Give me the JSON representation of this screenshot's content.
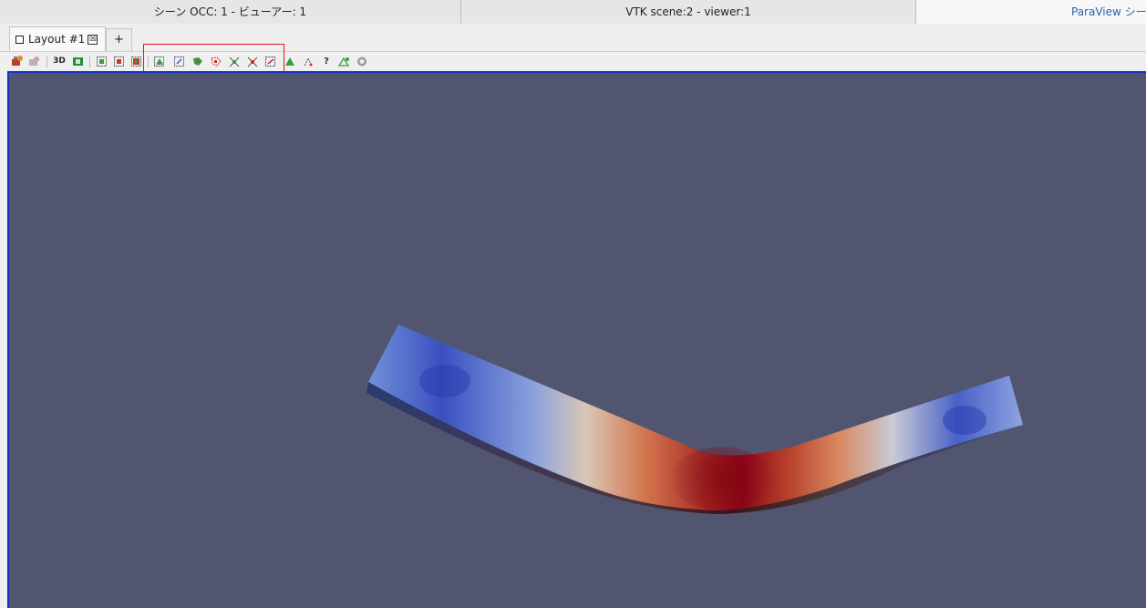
{
  "viewer_tabs": [
    {
      "label": "シーン OCC: 1 - ビューアー: 1"
    },
    {
      "label": "VTK scene:2 - viewer:1"
    },
    {
      "label": "ParaView シーン"
    }
  ],
  "layout_tab": {
    "label": "Layout #1",
    "close_glyph": "☒"
  },
  "add_tab": {
    "label": "+"
  },
  "toolbar": {
    "three_d_label": "3D",
    "query_label": "?"
  },
  "icons": [
    "reset-camera-icon",
    "zoom-to-data-icon",
    "toggle-3d-icon",
    "capture-screenshot-icon",
    "select-cells-on-icon",
    "select-points-on-icon",
    "select-cells-through-icon",
    "select-points-through-icon",
    "select-cells-polygon-icon",
    "select-points-polygon-icon",
    "select-block-icon",
    "interactive-select-cells-icon",
    "interactive-select-points-icon",
    "hover-points-icon",
    "grow-selection-icon",
    "shrink-selection-icon",
    "query-icon",
    "hover-cells-icon",
    "clear-selection-icon"
  ],
  "colors": {
    "background": "#525570",
    "active_tab_text": "#2a63b5",
    "frame": "#1432c8",
    "highlight": "#e0141e",
    "colormap_low": "#3a4fbf",
    "colormap_mid": "#dcdcdc",
    "colormap_high": "#b40426"
  }
}
